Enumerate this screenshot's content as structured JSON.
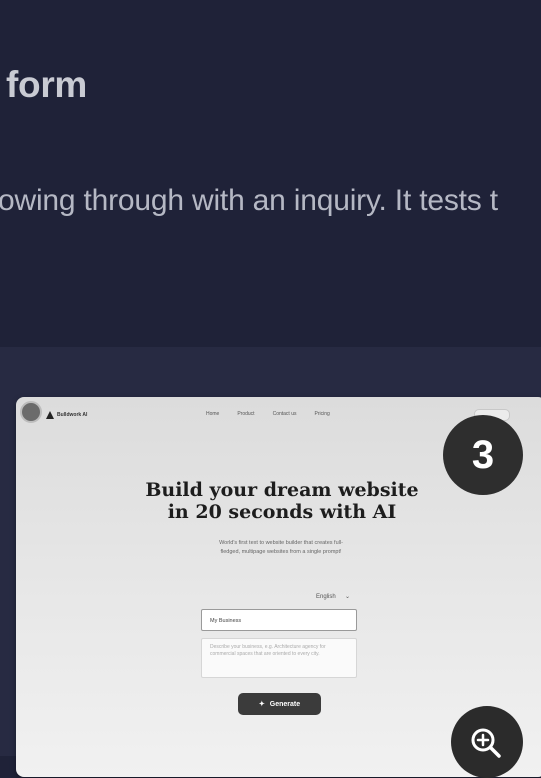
{
  "header": {
    "title": "form",
    "description": "owing through with an inquiry. It tests t"
  },
  "preview": {
    "logo_text": "Bulldwork AI",
    "nav_items": [
      "Home",
      "Product",
      "Contact us",
      "Pricing"
    ],
    "hero_title_line1": "Build your dream website",
    "hero_title_line2": "in 20 seconds with AI",
    "hero_subtitle_line1": "World's first text to website builder that creates full-",
    "hero_subtitle_line2": "fledged, multipage websites from a single prompt!",
    "language": "English",
    "business_name_value": "My Business",
    "description_placeholder": "Describe your business, e.g. Architecture agency for commercial spaces that are oriented to every city.",
    "generate_label": "Generate"
  },
  "step_badge": "3",
  "icons": {
    "zoom": "zoom-in-icon",
    "avatar": "avatar",
    "logo": "logo-icon",
    "sparkle": "sparkle-icon",
    "chevron": "chevron-down-icon"
  }
}
